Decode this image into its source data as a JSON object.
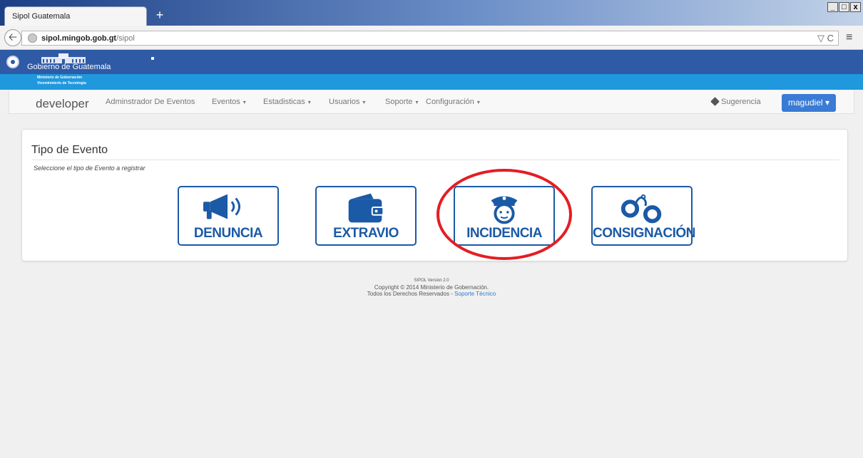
{
  "browser": {
    "tab_title": "Sipol Guatemala",
    "new_tab": "+",
    "window_controls": [
      "_",
      "□",
      "x"
    ],
    "url_host": "sipol.mingob.gob.gt",
    "url_path": "/sipol",
    "reload": "▽ C",
    "menu": "≡"
  },
  "gov": {
    "name": "Gobierno de Guatemala",
    "ministry_line1": "Ministerio de Gobernación",
    "ministry_line2": "Viceministerio de Tecnología"
  },
  "nav": {
    "brand": "developer",
    "items": [
      {
        "label": "Adminstrador De Eventos",
        "caret": false
      },
      {
        "label": "Eventos",
        "caret": true
      },
      {
        "label": "Estadisticas",
        "caret": true
      },
      {
        "label": "Usuarios",
        "caret": true
      },
      {
        "label": "Soporte",
        "caret": true
      },
      {
        "label": "Configuración",
        "caret": true
      }
    ],
    "caret_glyph": "▾",
    "suggestion": "Sugerencia",
    "user": "magudiel ▾"
  },
  "panel": {
    "title": "Tipo de Evento",
    "subtitle": "Seleccione el tipo de Evento a registrar",
    "events": [
      {
        "label": "DENUNCIA",
        "icon": "megaphone-icon"
      },
      {
        "label": "EXTRAVIO",
        "icon": "wallet-icon"
      },
      {
        "label": "INCIDENCIA",
        "icon": "police-officer-icon",
        "highlighted": true
      },
      {
        "label": "CONSIGNACIÓN",
        "icon": "handcuffs-icon"
      }
    ]
  },
  "footer": {
    "version": "SIPOL Version 2.0",
    "copyright": "Copyright © 2014 Ministerio de Gobernación.",
    "rights": "Todos los Derechos Reservados - ",
    "support_link": "Soporte Técnico"
  },
  "colors": {
    "brand_blue": "#1b5aa6",
    "gov_blue": "#2e5aa6",
    "ministry_blue": "#1f98de",
    "highlight_red": "#e31e24",
    "user_button": "#3a7bd5"
  }
}
